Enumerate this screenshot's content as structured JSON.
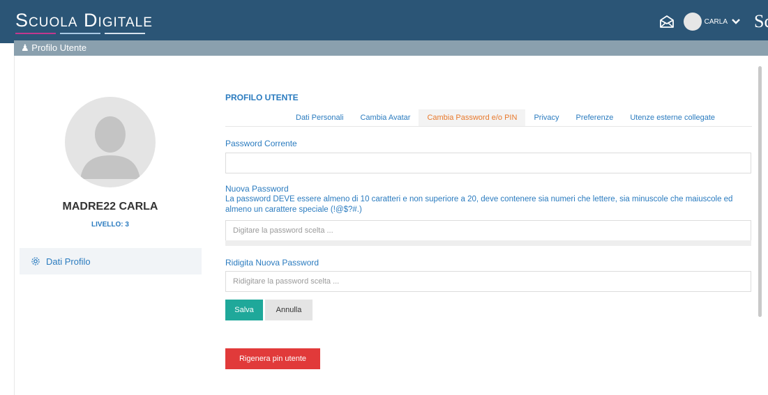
{
  "navbar": {
    "brand": "Scuola Digitale",
    "icons": {
      "mail": "envelope-open-icon",
      "chevron": "chevron-down-icon"
    },
    "user_name": "CARLA",
    "cut_text": "Sc",
    "colors": {
      "background": "#2b5576",
      "brand_accent_1": "#c2388f",
      "brand_accent_2": "#a9c8e3"
    }
  },
  "section_bar": {
    "icon": "user-icon",
    "title": "Profilo Utente"
  },
  "profile": {
    "name": "MADRE22 CARLA",
    "level": "LIVELLO: 3",
    "sidebar_item": {
      "icon": "gear-icon",
      "label": "Dati Profilo"
    }
  },
  "main": {
    "title": "PROFILO UTENTE",
    "tabs": [
      {
        "label": "Dati Personali",
        "active": false
      },
      {
        "label": "Cambia Avatar",
        "active": false
      },
      {
        "label": "Cambia Password e/o PIN",
        "active": true
      },
      {
        "label": "Privacy",
        "active": false
      },
      {
        "label": "Preferenze",
        "active": false
      },
      {
        "label": "Utenze esterne collegate",
        "active": false
      }
    ],
    "current_password": {
      "label": "Password Corrente",
      "value": "",
      "placeholder": ""
    },
    "new_password": {
      "label": "Nuova Password",
      "help": "La password DEVE essere almeno di 10 caratteri e non superiore a 20, deve contenere sia numeri che lettere, sia minuscole che maiuscole ed almeno un carattere speciale (!@$?#.)",
      "placeholder": "Digitare la password scelta ..."
    },
    "repeat_password": {
      "label": "Ridigita Nuova Password",
      "placeholder": "Ridigitare la password scelta ..."
    },
    "buttons": {
      "save": "Salva",
      "cancel": "Annulla",
      "regenerate_pin": "Rigenera pin utente"
    },
    "colors": {
      "accent": "#2a7bbf",
      "active_tab": "#e8792c",
      "save": "#1fa89a",
      "danger": "#e13a3a"
    }
  }
}
